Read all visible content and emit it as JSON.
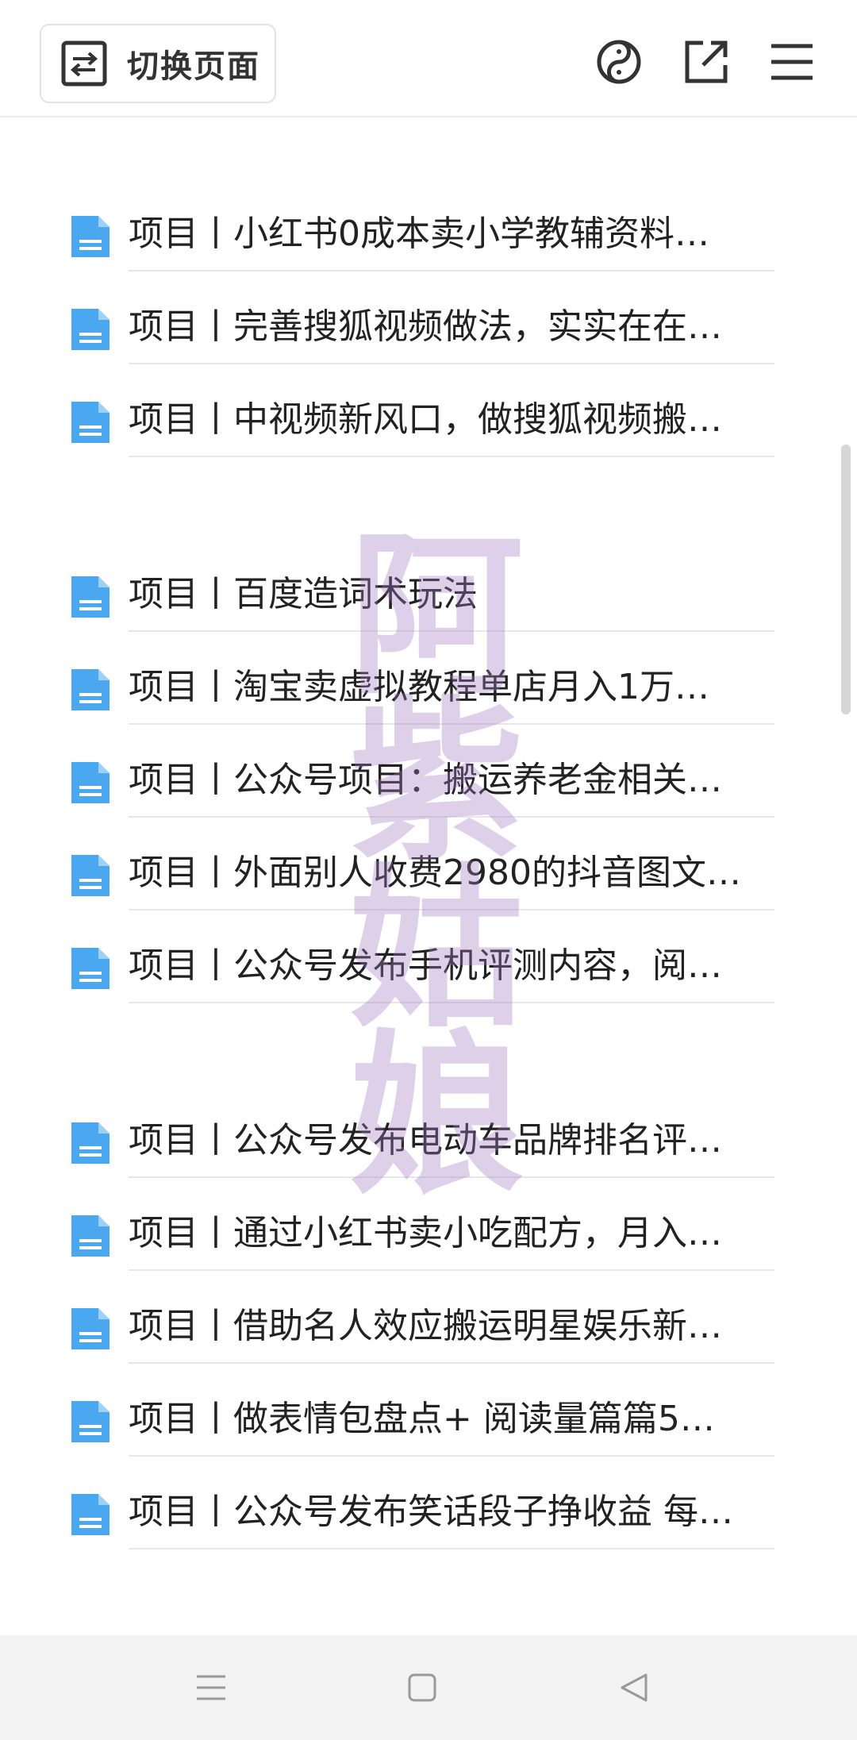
{
  "toolbar": {
    "switch_label": "切换页面",
    "switch_icon": "swap-arrows-icon",
    "icons": [
      "yin-yang-icon",
      "open-external-icon",
      "menu-icon"
    ]
  },
  "groups": [
    {
      "items": [
        "项目丨小红书0成本卖小学教辅资料…",
        "项目丨完善搜狐视频做法，实实在在…",
        "项目丨中视频新风口，做搜狐视频搬…"
      ]
    },
    {
      "items": [
        "项目丨百度造词术玩法",
        "项目丨淘宝卖虚拟教程单店月入1万…",
        "项目丨公众号项目：搬运养老金相关…",
        "项目丨外面别人收费2980的抖音图文…",
        "项目丨公众号发布手机评测内容，阅…"
      ]
    },
    {
      "items": [
        "项目丨公众号发布电动车品牌排名评…",
        "项目丨通过小红书卖小吃配方，月入…",
        "项目丨借助名人效应搬运明星娱乐新…",
        "项目丨做表情包盘点+ 阅读量篇篇5…",
        "项目丨公众号发布笑话段子挣收益 每…"
      ]
    }
  ],
  "watermark": [
    "阿",
    "紫",
    "姑",
    "娘"
  ],
  "colors": {
    "file_icon": "#4aa8f0",
    "watermark": "#a078be",
    "divider": "#e7e7e7"
  },
  "navbar": {
    "icons": [
      "recent-apps-icon",
      "home-square-icon",
      "back-triangle-icon"
    ]
  }
}
